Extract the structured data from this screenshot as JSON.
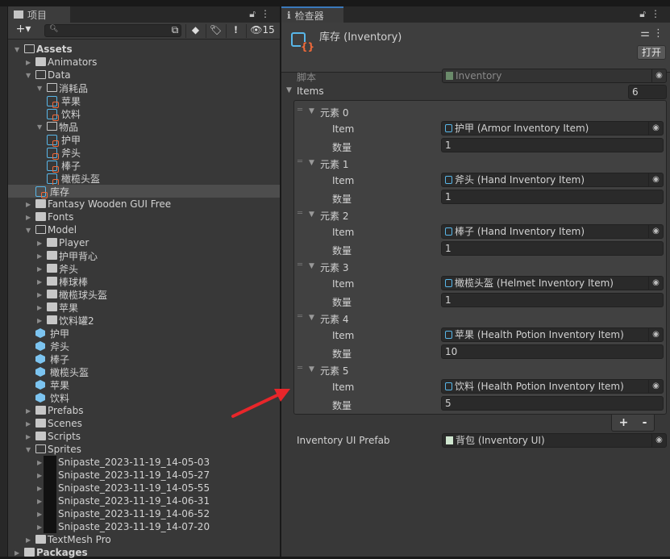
{
  "project": {
    "tab_label": "项目",
    "item_count_hidden": "15",
    "search_placeholder": "",
    "tree": [
      {
        "label": "Assets",
        "depth": 0,
        "type": "folder",
        "expanded": true,
        "bold": true
      },
      {
        "label": "Animators",
        "depth": 1,
        "type": "folder",
        "expanded": false
      },
      {
        "label": "Data",
        "depth": 1,
        "type": "folder",
        "expanded": true
      },
      {
        "label": "消耗品",
        "depth": 2,
        "type": "folder",
        "expanded": true
      },
      {
        "label": "苹果",
        "depth": 3,
        "type": "scriptable"
      },
      {
        "label": "饮料",
        "depth": 3,
        "type": "scriptable"
      },
      {
        "label": "物品",
        "depth": 2,
        "type": "folder",
        "expanded": true
      },
      {
        "label": "护甲",
        "depth": 3,
        "type": "scriptable"
      },
      {
        "label": "斧头",
        "depth": 3,
        "type": "scriptable"
      },
      {
        "label": "棒子",
        "depth": 3,
        "type": "scriptable"
      },
      {
        "label": "橄榄头盔",
        "depth": 3,
        "type": "scriptable"
      },
      {
        "label": "库存",
        "depth": 2,
        "type": "scriptable",
        "selected": true
      },
      {
        "label": "Fantasy Wooden GUI  Free",
        "depth": 1,
        "type": "folder",
        "expanded": false
      },
      {
        "label": "Fonts",
        "depth": 1,
        "type": "folder",
        "expanded": false
      },
      {
        "label": "Model",
        "depth": 1,
        "type": "folder",
        "expanded": true
      },
      {
        "label": "Player",
        "depth": 2,
        "type": "folder",
        "expanded": false
      },
      {
        "label": "护甲背心",
        "depth": 2,
        "type": "folder",
        "expanded": false
      },
      {
        "label": "斧头",
        "depth": 2,
        "type": "folder",
        "expanded": false
      },
      {
        "label": "棒球棒",
        "depth": 2,
        "type": "folder",
        "expanded": false
      },
      {
        "label": "橄榄球头盔",
        "depth": 2,
        "type": "folder",
        "expanded": false
      },
      {
        "label": "苹果",
        "depth": 2,
        "type": "folder",
        "expanded": false
      },
      {
        "label": "饮料罐2",
        "depth": 2,
        "type": "folder",
        "expanded": false
      },
      {
        "label": "护甲",
        "depth": 2,
        "type": "prefab"
      },
      {
        "label": "斧头",
        "depth": 2,
        "type": "prefab"
      },
      {
        "label": "棒子",
        "depth": 2,
        "type": "prefab"
      },
      {
        "label": "橄榄头盔",
        "depth": 2,
        "type": "prefab"
      },
      {
        "label": "苹果",
        "depth": 2,
        "type": "prefab"
      },
      {
        "label": "饮料",
        "depth": 2,
        "type": "prefab"
      },
      {
        "label": "Prefabs",
        "depth": 1,
        "type": "folder",
        "expanded": false
      },
      {
        "label": "Scenes",
        "depth": 1,
        "type": "folder",
        "expanded": false
      },
      {
        "label": "Scripts",
        "depth": 1,
        "type": "folder",
        "expanded": false
      },
      {
        "label": "Sprites",
        "depth": 1,
        "type": "folder",
        "expanded": true
      },
      {
        "label": "Snipaste_2023-11-19_14-05-03",
        "depth": 2,
        "type": "sprite"
      },
      {
        "label": "Snipaste_2023-11-19_14-05-27",
        "depth": 2,
        "type": "sprite"
      },
      {
        "label": "Snipaste_2023-11-19_14-05-55",
        "depth": 2,
        "type": "sprite"
      },
      {
        "label": "Snipaste_2023-11-19_14-06-31",
        "depth": 2,
        "type": "sprite"
      },
      {
        "label": "Snipaste_2023-11-19_14-06-52",
        "depth": 2,
        "type": "sprite"
      },
      {
        "label": "Snipaste_2023-11-19_14-07-20",
        "depth": 2,
        "type": "sprite"
      },
      {
        "label": "TextMesh Pro",
        "depth": 1,
        "type": "folder",
        "expanded": false
      },
      {
        "label": "Packages",
        "depth": 0,
        "type": "folder",
        "expanded": false,
        "bold": true
      }
    ]
  },
  "inspector": {
    "tab_label": "检查器",
    "title": "库存 (Inventory)",
    "open_label": "打开",
    "script_label": "脚本",
    "script_value": "Inventory",
    "items_label": "Items",
    "items_count": "6",
    "item_label": "Item",
    "qty_label": "数量",
    "elements": [
      {
        "header": "元素 0",
        "item": "护甲 (Armor Inventory Item)",
        "qty": "1"
      },
      {
        "header": "元素 1",
        "item": "斧头 (Hand Inventory Item)",
        "qty": "1"
      },
      {
        "header": "元素 2",
        "item": "棒子 (Hand Inventory Item)",
        "qty": "1"
      },
      {
        "header": "元素 3",
        "item": "橄榄头盔 (Helmet Inventory Item)",
        "qty": "1"
      },
      {
        "header": "元素 4",
        "item": "苹果 (Health Potion Inventory Item)",
        "qty": "10"
      },
      {
        "header": "元素 5",
        "item": "饮料 (Health Potion Inventory Item)",
        "qty": "5"
      }
    ],
    "add_label": "+",
    "remove_label": "-",
    "prefab_label": "Inventory UI Prefab",
    "prefab_value": "背包 (Inventory UI)"
  },
  "colors": {
    "accent": "#3a79bb",
    "annotation_arrow": "#e8262a",
    "scriptable_icon": "#58b6e8",
    "brace": "#f06a3a"
  }
}
